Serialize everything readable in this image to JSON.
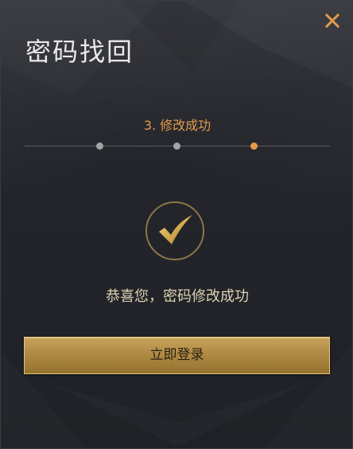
{
  "dialog": {
    "title": "密码找回",
    "close_icon": "close-icon"
  },
  "steps": {
    "current_label": "3. 修改成功",
    "total": 3,
    "current": 3
  },
  "result": {
    "icon": "check-icon",
    "message": "恭喜您，密码修改成功"
  },
  "actions": {
    "login_label": "立即登录"
  },
  "colors": {
    "accent": "#e39a4a",
    "gold": "#b08a44",
    "background": "#23252b"
  }
}
